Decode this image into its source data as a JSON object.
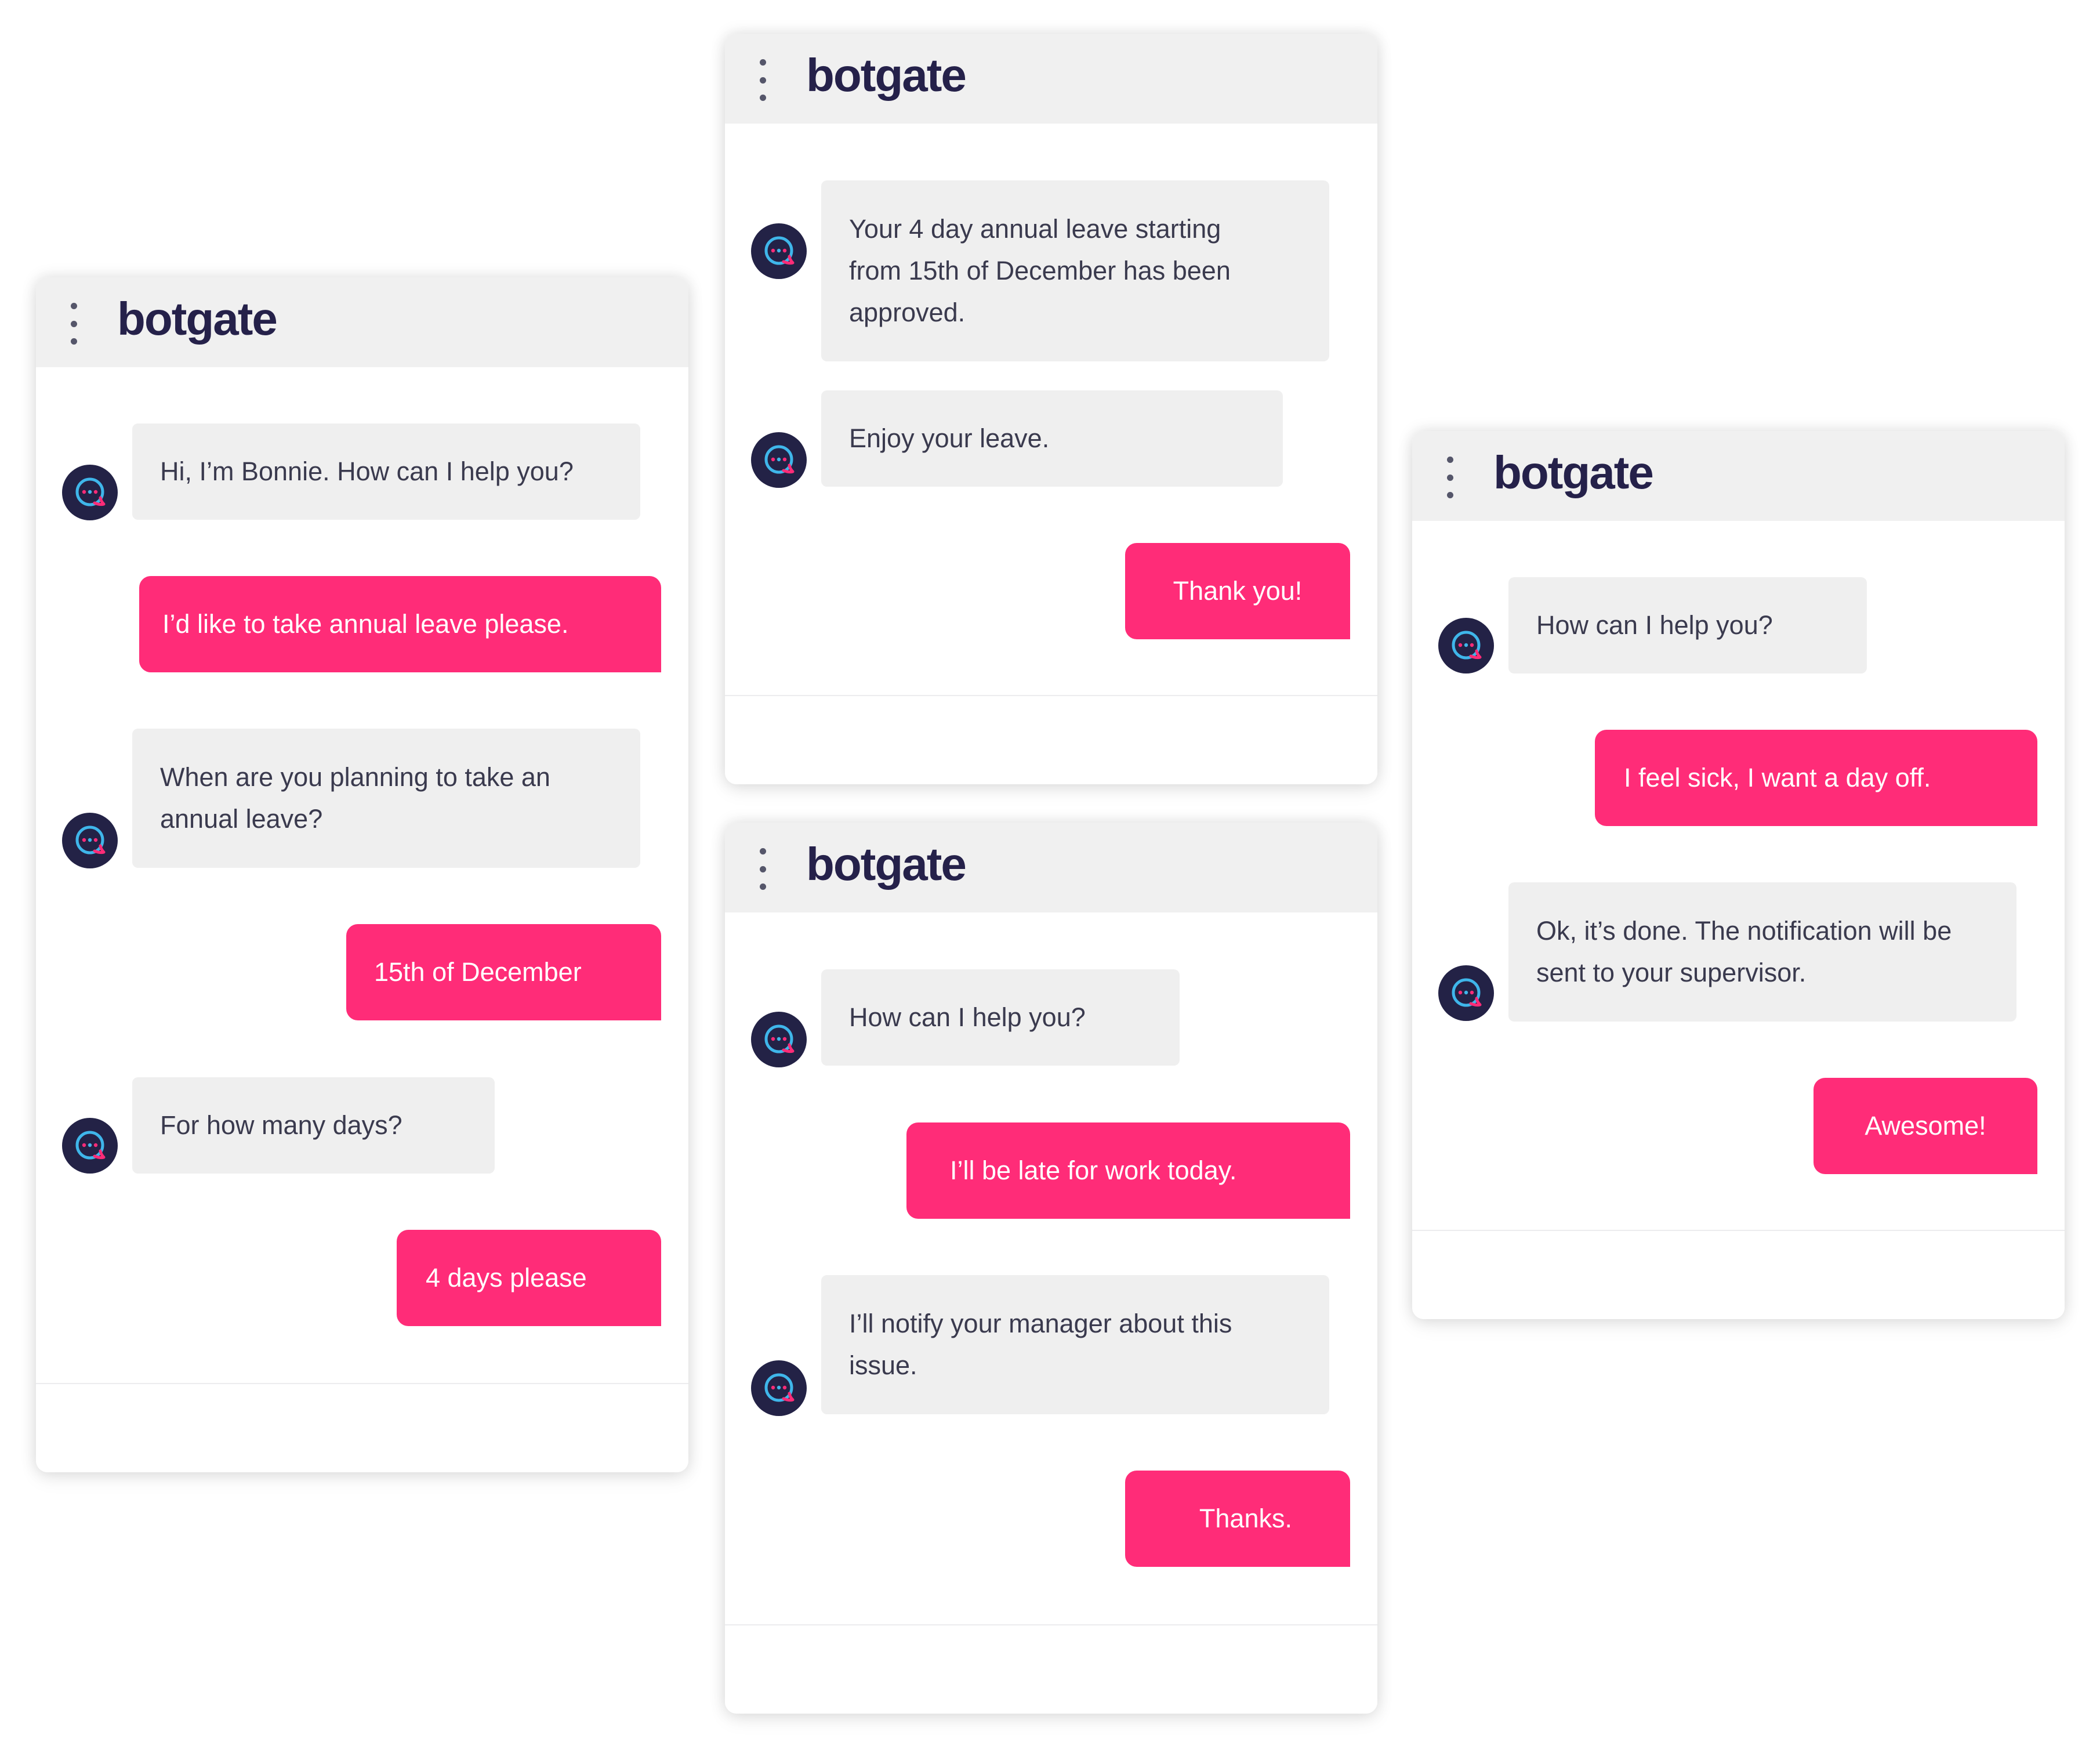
{
  "brand": "botgate",
  "colors": {
    "accent": "#ff2c78",
    "bot_bubble": "#efefef",
    "header": "#f0f0f0",
    "avatar": "#232246"
  },
  "icons": {
    "menu": "kebab-menu-icon",
    "avatar": "chat-bubble-avatar-icon"
  },
  "win1": {
    "m1": "Hi, I’m Bonnie. How can I help you?",
    "m2": "I’d like to take annual leave please.",
    "m3": "When are you planning to take an annual leave?",
    "m4": "15th of December",
    "m5": "For how many days?",
    "m6": "4 days please"
  },
  "win2": {
    "m1": "Your 4 day annual leave starting from 15th of December has been approved.",
    "m2": "Enjoy your leave.",
    "m3": "Thank you!"
  },
  "win3": {
    "m1": "How can I help you?",
    "m2": "I’ll be late for work today.",
    "m3": "I’ll notify your manager about this issue.",
    "m4": "Thanks."
  },
  "win4": {
    "m1": "How can I help you?",
    "m2": "I feel sick, I want a day off.",
    "m3": "Ok, it’s done. The notification will be sent to your supervisor.",
    "m4": "Awesome!"
  }
}
